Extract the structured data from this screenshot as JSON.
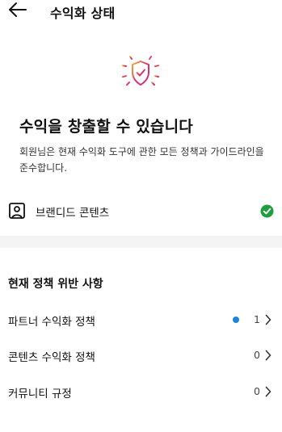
{
  "header": {
    "title": "수익화 상태",
    "back_icon": "arrow-left-icon"
  },
  "hero": {
    "icon": "shield-check-icon",
    "gradient": [
      "#f7b733",
      "#e1306c",
      "#c13584"
    ]
  },
  "headline": "수익을 창출할 수 있습니다",
  "description": "회원님은 현재 수익화 도구에 관한 모든 정책과 가이드라인을 준수합니다.",
  "branded_content": {
    "label": "브랜디드 콘텐츠",
    "icon": "branded-content-icon",
    "status_icon": "check-circle-icon",
    "status_color": "#1e9e3e"
  },
  "violations": {
    "title": "현재 정책 위반 사항",
    "items": [
      {
        "label": "파트너 수익화 정책",
        "count": "1",
        "unread": true
      },
      {
        "label": "콘텐츠 수익화 정책",
        "count": "0",
        "unread": false
      },
      {
        "label": "커뮤니티 규정",
        "count": "0",
        "unread": false
      }
    ]
  },
  "colors": {
    "unread_dot": "#1a84e0",
    "divider": "#f4f4f4"
  }
}
